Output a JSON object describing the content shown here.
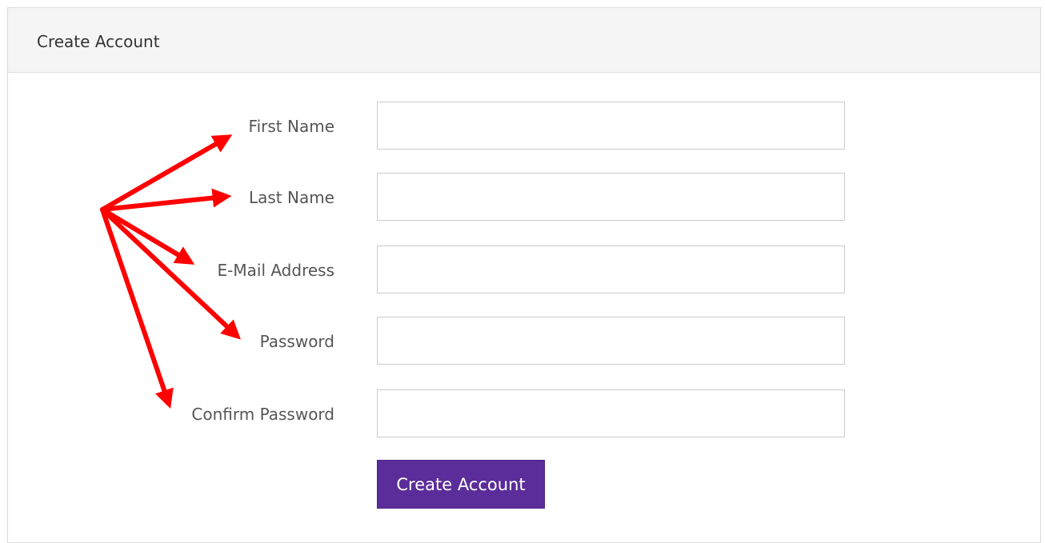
{
  "panel": {
    "title": "Create Account"
  },
  "form": {
    "fields": [
      {
        "label": "First Name",
        "value": "",
        "placeholder": ""
      },
      {
        "label": "Last Name",
        "value": "",
        "placeholder": ""
      },
      {
        "label": "E-Mail Address",
        "value": "",
        "placeholder": ""
      },
      {
        "label": "Password",
        "value": "",
        "placeholder": ""
      },
      {
        "label": "Confirm Password",
        "value": "",
        "placeholder": ""
      }
    ],
    "submit_label": "Create Account"
  },
  "colors": {
    "accent": "#5b2d9a",
    "annotation": "#ff0000",
    "heading_bg": "#f5f5f5"
  }
}
